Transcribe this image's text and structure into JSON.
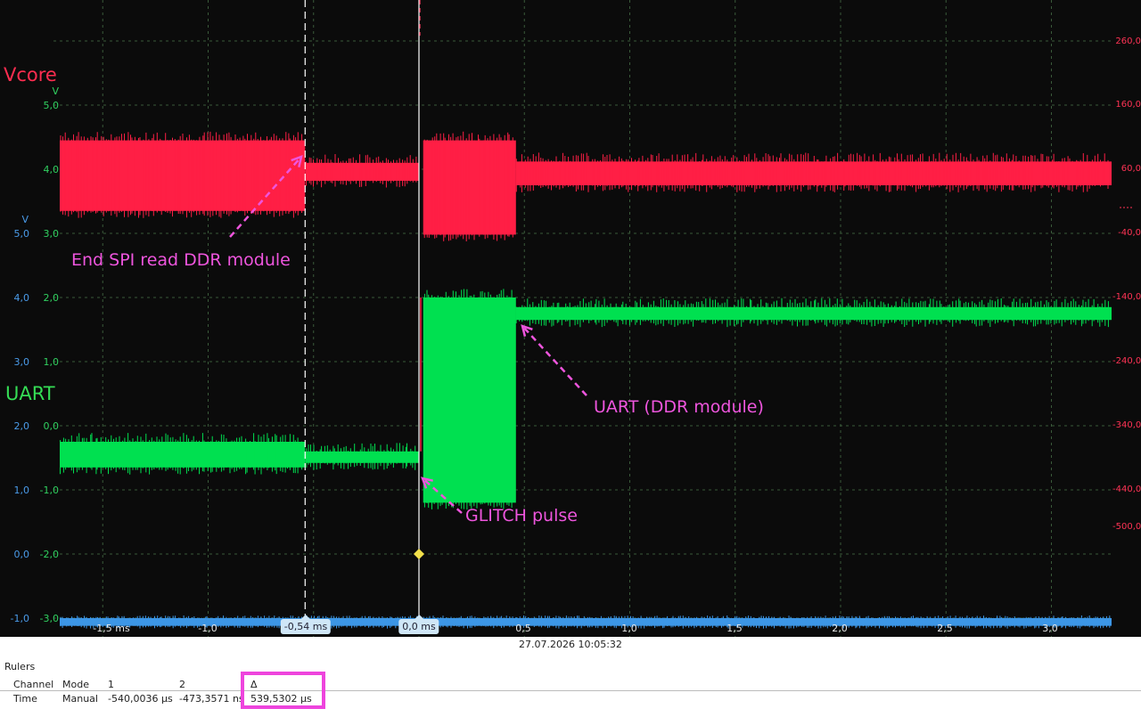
{
  "chart_data": {
    "type": "line",
    "title": "",
    "x_unit": "ms",
    "x_range": [
      -1.72,
      3.3
    ],
    "x_ticks": [
      {
        "v": -1.5,
        "label": "-1,5 ms"
      },
      {
        "v": -1.0,
        "label": "-1,0"
      },
      {
        "v": 0.5,
        "label": "0,5"
      },
      {
        "v": 1.0,
        "label": "1,0"
      },
      {
        "v": 1.5,
        "label": "1,5"
      },
      {
        "v": 2.0,
        "label": "2,0"
      },
      {
        "v": 2.5,
        "label": "2,5"
      },
      {
        "v": 3.0,
        "label": "3,0"
      }
    ],
    "grid": true,
    "axes": {
      "blue": {
        "unit": "V",
        "ticks": [
          "5,0",
          "4,0",
          "3,0",
          "2,0",
          "1,0",
          "0,0",
          "-1,0"
        ],
        "color": "#4a9be8"
      },
      "green": {
        "unit": "",
        "ticks": [
          "3,0",
          "2,0",
          "1,0",
          "0,0",
          "-1,0",
          "-2,0",
          "-3,0"
        ],
        "color": "#30d060"
      },
      "red_left": {
        "unit": "V",
        "ticks": [
          "5,0",
          "4,0"
        ],
        "color": "#30d060"
      },
      "red_right": {
        "ticks": [
          "260,0",
          "160,0",
          "60,0",
          "-40,0",
          "-140,0",
          "-240,0",
          "-340,0",
          "-440,0",
          "-500,0"
        ],
        "color": "#ff3355"
      }
    },
    "series": [
      {
        "name": "Vcore",
        "color": "#ff1f45",
        "segments": [
          {
            "x": [
              -1.72,
              -0.54
            ],
            "top": 5.45,
            "bottom": 4.35
          },
          {
            "x": [
              -0.54,
              0.0
            ],
            "top": 5.1,
            "bottom": 4.82
          },
          {
            "x": [
              0.02,
              0.46
            ],
            "top": 5.45,
            "bottom": 3.98
          },
          {
            "x": [
              0.46,
              3.3
            ],
            "top": 5.12,
            "bottom": 4.75
          }
        ]
      },
      {
        "name": "UART",
        "color": "#00e050",
        "segments": [
          {
            "x": [
              -1.72,
              -0.54
            ],
            "top": 0.75,
            "bottom": 0.35
          },
          {
            "x": [
              -0.54,
              0.0
            ],
            "top": 0.6,
            "bottom": 0.42
          },
          {
            "x": [
              0.02,
              0.46
            ],
            "top": 3.0,
            "bottom": -0.2
          },
          {
            "x": [
              0.46,
              3.3
            ],
            "top": 2.85,
            "bottom": 2.65
          }
        ]
      },
      {
        "name": "",
        "color": "#3c96e6",
        "segments": [
          {
            "x": [
              -1.72,
              3.3
            ],
            "top": -2.0,
            "bottom": -2.12
          }
        ]
      }
    ],
    "channel_labels": {
      "vcore": "Vcore",
      "uart": "UART"
    },
    "annotations": [
      {
        "text": "End SPI read DDR module"
      },
      {
        "text": "UART (DDR module)"
      },
      {
        "text": "GLITCH pulse"
      }
    ],
    "cursors": [
      {
        "x": -0.54,
        "label": "-0,54 ms"
      },
      {
        "x": 0.0,
        "label": "0,0 ms"
      }
    ],
    "marker_color": "#f2e04a"
  },
  "timestamp": "27.07.2026 10:05:32",
  "rulers": {
    "title": "Rulers",
    "headers": {
      "channel": "Channel",
      "mode": "Mode",
      "c1": "1",
      "c2": "2",
      "delta": "Δ"
    },
    "row": {
      "channel": "Time",
      "mode": "Manual",
      "c1": "-540,0036 µs",
      "c2": "-473,3571 ns",
      "delta": "539,5302 µs"
    }
  }
}
